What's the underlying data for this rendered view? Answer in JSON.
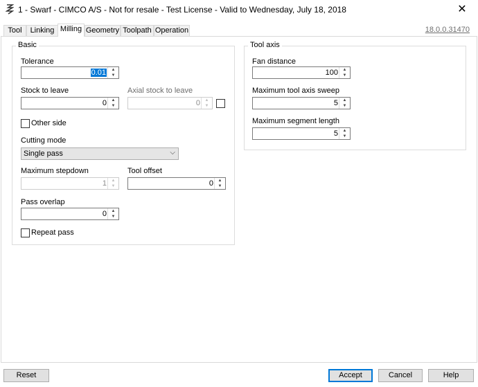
{
  "window": {
    "title": "1 - Swarf - CIMCO A/S - Not for resale - Test License - Valid to Wednesday, July 18, 2018",
    "close_glyph": "✕"
  },
  "tabs": [
    "Tool",
    "Linking",
    "Milling",
    "Geometry",
    "Toolpath",
    "Operation"
  ],
  "active_tab": "Milling",
  "version": "18.0.0.31470",
  "basic": {
    "title": "Basic",
    "tolerance": {
      "label": "Tolerance",
      "value": "0.01"
    },
    "stock_to_leave": {
      "label": "Stock to leave",
      "value": "0"
    },
    "axial_stock": {
      "label": "Axial stock to leave",
      "value": "0"
    },
    "other_side": {
      "label": "Other side",
      "checked": false
    },
    "cutting_mode": {
      "label": "Cutting mode",
      "value": "Single pass"
    },
    "max_stepdown": {
      "label": "Maximum stepdown",
      "value": "1"
    },
    "tool_offset": {
      "label": "Tool offset",
      "value": "0"
    },
    "pass_overlap": {
      "label": "Pass overlap",
      "value": "0"
    },
    "repeat_pass": {
      "label": "Repeat pass",
      "checked": false
    }
  },
  "tool_axis": {
    "title": "Tool axis",
    "fan_distance": {
      "label": "Fan distance",
      "value": "100"
    },
    "max_sweep": {
      "label": "Maximum tool axis sweep",
      "value": "5"
    },
    "max_segment": {
      "label": "Maximum segment length",
      "value": "5"
    }
  },
  "buttons": {
    "reset": "Reset",
    "accept": "Accept",
    "cancel": "Cancel",
    "help": "Help"
  },
  "icons": {
    "up_arrow": "▲",
    "down_arrow": "▼",
    "dropdown": "⌵"
  }
}
